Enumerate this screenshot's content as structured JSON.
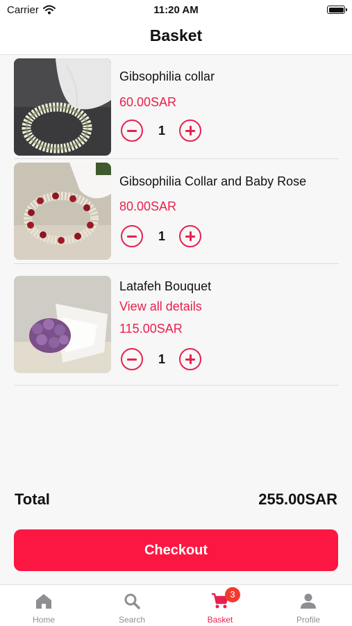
{
  "status": {
    "carrier": "Carrier",
    "time": "11:20 AM"
  },
  "header": {
    "title": "Basket"
  },
  "items": [
    {
      "name": "Gibsophilia collar",
      "details_link": "",
      "price": "60.00SAR",
      "quantity": "1",
      "image": "gypsophila-crown-photo"
    },
    {
      "name": "Gibsophilia Collar and Baby Rose",
      "details_link": "",
      "price": "80.00SAR",
      "quantity": "1",
      "image": "rose-crown-photo"
    },
    {
      "name": "Latafeh Bouquet",
      "details_link": "View all details",
      "price": "115.00SAR",
      "quantity": "1",
      "image": "purple-rose-bouquet-photo"
    }
  ],
  "summary": {
    "total_label": "Total",
    "total_value": "255.00SAR"
  },
  "checkout": {
    "label": "Checkout"
  },
  "tabbar": {
    "tabs": [
      {
        "label": "Home",
        "icon": "home-icon"
      },
      {
        "label": "Search",
        "icon": "search-icon"
      },
      {
        "label": "Basket",
        "icon": "cart-icon",
        "badge": "3",
        "active": true
      },
      {
        "label": "Profile",
        "icon": "person-icon"
      }
    ]
  },
  "colors": {
    "accent": "#e8204d",
    "button": "#fc1742",
    "badge": "#f23b2e",
    "inactive": "#8e8e93"
  }
}
